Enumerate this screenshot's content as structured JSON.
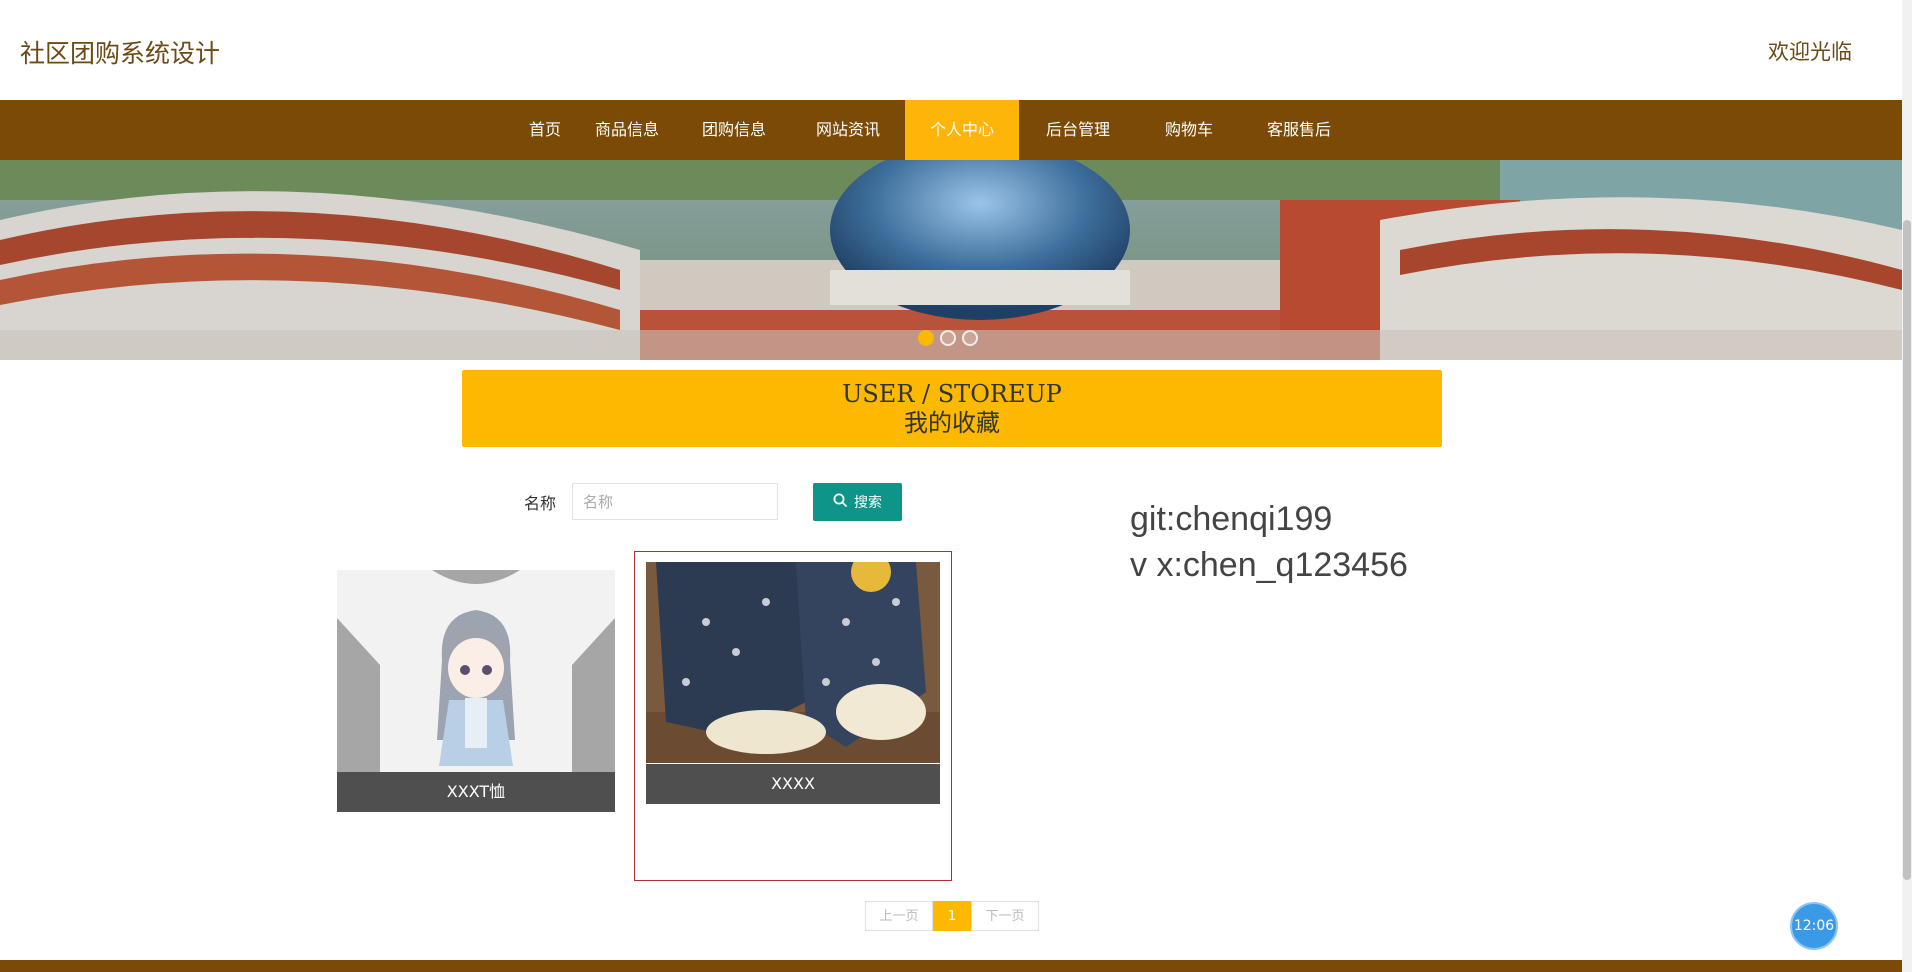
{
  "header": {
    "title": "社区团购系统设计",
    "welcome": "欢迎光临"
  },
  "nav": {
    "items": [
      {
        "label": "首页"
      },
      {
        "label": "商品信息"
      },
      {
        "label": "团购信息"
      },
      {
        "label": "网站资讯"
      },
      {
        "label": "个人中心",
        "active": true
      },
      {
        "label": "后台管理"
      },
      {
        "label": "购物车"
      },
      {
        "label": "客服售后"
      }
    ]
  },
  "banner": {
    "slides": 3,
    "current": 1
  },
  "section": {
    "title_en": "USER / STOREUP",
    "title_cn": "我的收藏"
  },
  "search": {
    "label": "名称",
    "placeholder": "名称",
    "button": "搜索"
  },
  "watermark": {
    "line1": "git:chenqi199",
    "line2": "v x:chen_q123456"
  },
  "items": [
    {
      "name": "XXXT恤"
    },
    {
      "name": "XXXX"
    }
  ],
  "pagination": {
    "prev": "上一页",
    "current": "1",
    "next": "下一页"
  },
  "clock": {
    "time": "12:06"
  },
  "colors": {
    "brand": "#7a4a06",
    "accent": "#fcb900",
    "search_button": "#0e9488"
  }
}
